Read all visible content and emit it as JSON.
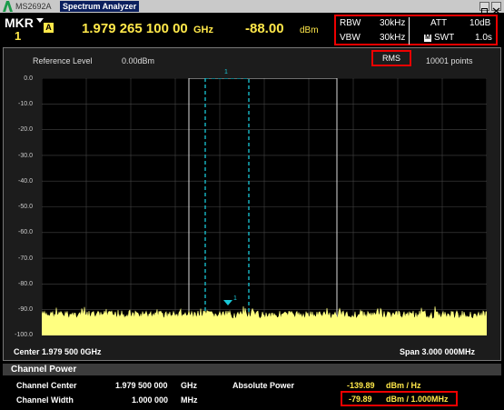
{
  "window": {
    "model": "MS2692A",
    "title": "Spectrum Analyzer"
  },
  "marker": {
    "label": "MKR",
    "number": "1",
    "mode_badge": "A",
    "frequency": "1.979 265 100 00",
    "frequency_unit": "GHz",
    "level": "-88.00",
    "level_unit": "dBm"
  },
  "params": {
    "rbw_label": "RBW",
    "rbw": "30kHz",
    "vbw_label": "VBW",
    "vbw": "30kHz",
    "att_label": "ATT",
    "att": "10dB",
    "swt_badge": "M",
    "swt_label": "SWT",
    "swt": "1.0s"
  },
  "trace": {
    "reference_label": "Reference Level",
    "reference_value": "0.00dBm",
    "detector": "RMS",
    "points": "10001 points",
    "y_ticks": [
      "0.0",
      "-10.0",
      "-20.0",
      "-30.0",
      "-40.0",
      "-50.0",
      "-60.0",
      "-70.0",
      "-80.0",
      "-90.0",
      "-100.0"
    ],
    "ylim": [
      -100,
      0
    ],
    "noise_floor_dbm": -92,
    "marker_id": "1",
    "marker_level_dbm": -88,
    "trace_color": "#ffff80",
    "grid_color": "#444444"
  },
  "axis": {
    "center": "Center 1.979 500 0GHz",
    "span": "Span 3.000 000MHz"
  },
  "channel_power": {
    "title": "Channel Power",
    "center_label": "Channel Center",
    "center_value": "1.979 500 000",
    "center_unit": "GHz",
    "width_label": "Channel Width",
    "width_value": "1.000 000",
    "width_unit": "MHz",
    "abs_label": "Absolute Power",
    "density_value": "-139.89",
    "density_unit": "dBm / Hz",
    "power_value": "-79.89",
    "power_unit": "dBm / 1.000MHz"
  },
  "colors": {
    "accent": "#ffe84a",
    "highlight": "#e00000",
    "channel": "#19c8d8"
  }
}
